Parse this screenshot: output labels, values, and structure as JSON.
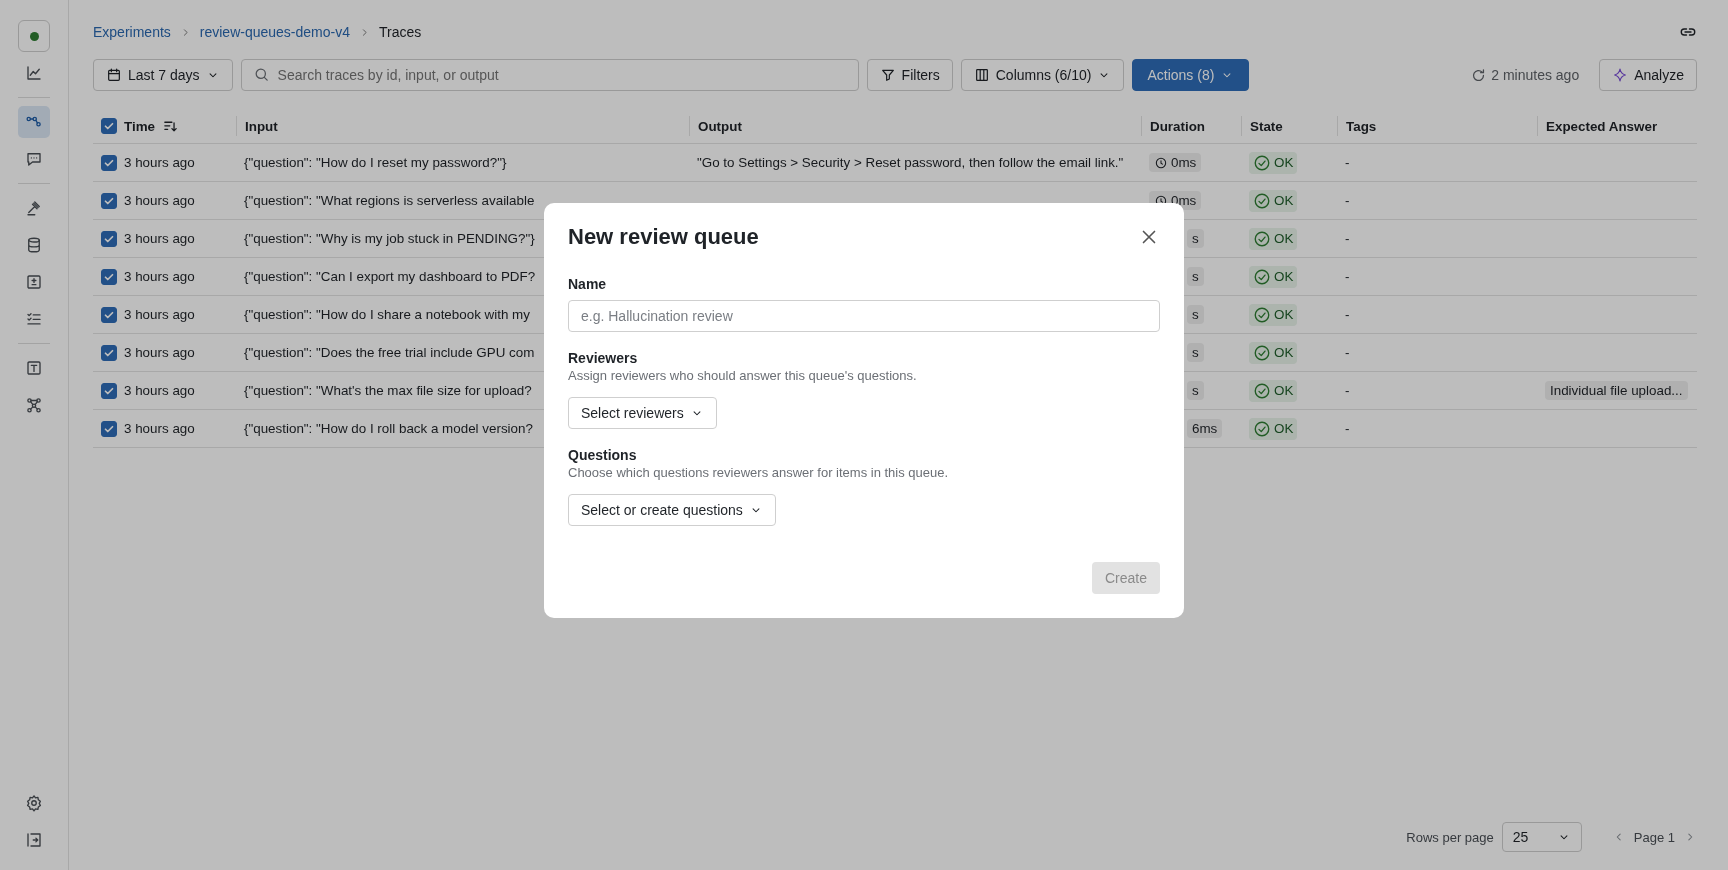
{
  "sidebar": {
    "groups": [
      [
        {
          "kind": "logo",
          "selected": false
        },
        {
          "kind": "chart",
          "selected": false
        }
      ],
      [
        {
          "kind": "traces",
          "selected": true
        },
        {
          "kind": "chat",
          "selected": false
        }
      ],
      [
        {
          "kind": "hammer",
          "selected": false
        },
        {
          "kind": "database",
          "selected": false
        },
        {
          "kind": "plusminus",
          "selected": false
        },
        {
          "kind": "checklist",
          "selected": false
        }
      ],
      [
        {
          "kind": "textbox",
          "selected": false
        },
        {
          "kind": "network",
          "selected": false
        }
      ]
    ],
    "bottom": [
      {
        "kind": "gear",
        "selected": false
      },
      {
        "kind": "collapse",
        "selected": false
      }
    ]
  },
  "breadcrumb": [
    {
      "label": "Experiments"
    },
    {
      "label": "review-queues-demo-v4"
    },
    {
      "label": "Traces"
    }
  ],
  "toolbar": {
    "date_range": "Last 7 days",
    "search": {
      "placeholder": "Search traces by id, input, or output"
    },
    "filters": "Filters",
    "columns": "Columns (6/10)",
    "actions": "Actions (8)",
    "refreshed": "2 minutes ago",
    "analyze": "Analyze"
  },
  "table": {
    "all_selected": true,
    "columns": [
      "Time",
      "Input",
      "Output",
      "Duration",
      "State",
      "Tags",
      "Expected Answer"
    ],
    "rows": [
      {
        "selected": true,
        "time": "3 hours ago",
        "input": "{\"question\": \"How do I reset my password?\"}",
        "output": "\"Go to Settings > Security > Reset password, then follow the email link.\"",
        "duration": {
          "text": "0ms",
          "clock": true
        },
        "state": "OK",
        "tags": "-"
      },
      {
        "selected": true,
        "time": "3 hours ago",
        "input": "{\"question\": \"What regions is serverless available",
        "duration": {
          "text": "0ms",
          "clock": true
        },
        "state": "OK",
        "tags": "-"
      },
      {
        "selected": true,
        "time": "3 hours ago",
        "input": "{\"question\": \"Why is my job stuck in PENDING?\"}",
        "duration": {
          "text": "s",
          "clock": false
        },
        "state": "OK",
        "tags": "-"
      },
      {
        "selected": true,
        "time": "3 hours ago",
        "input": "{\"question\": \"Can I export my dashboard to PDF?",
        "duration": {
          "text": "s",
          "clock": false
        },
        "state": "OK",
        "tags": "-"
      },
      {
        "selected": true,
        "time": "3 hours ago",
        "input": "{\"question\": \"How do I share a notebook with my",
        "duration": {
          "text": "s",
          "clock": false
        },
        "state": "OK",
        "tags": "-"
      },
      {
        "selected": true,
        "time": "3 hours ago",
        "input": "{\"question\": \"Does the free trial include GPU com",
        "duration": {
          "text": "s",
          "clock": false
        },
        "state": "OK",
        "tags": "-"
      },
      {
        "selected": true,
        "time": "3 hours ago",
        "input": "{\"question\": \"What's the max file size for upload?",
        "duration": {
          "text": "s",
          "clock": false
        },
        "state": "OK",
        "tags": "-",
        "expected_answer": "Individual file upload..."
      },
      {
        "selected": true,
        "time": "3 hours ago",
        "input": "{\"question\": \"How do I roll back a model version?",
        "duration": {
          "text": "6ms",
          "clock": false
        },
        "state": "OK",
        "tags": "-"
      }
    ]
  },
  "pagination": {
    "rows_per_page_label": "Rows per page",
    "rows_per_page": "25",
    "page": "Page 1"
  },
  "modal": {
    "title": "New review queue",
    "fields": [
      {
        "kind": "text",
        "label": "Name",
        "placeholder": "e.g. Hallucination review"
      },
      {
        "kind": "select",
        "label": "Reviewers",
        "hint": "Assign reviewers who should answer this queue's questions.",
        "value": "Select reviewers"
      },
      {
        "kind": "select",
        "label": "Questions",
        "hint": "Choose which questions reviewers answer for items in this queue.",
        "value": "Select or create questions"
      }
    ],
    "create": {
      "label": "Create",
      "disabled": true
    }
  }
}
